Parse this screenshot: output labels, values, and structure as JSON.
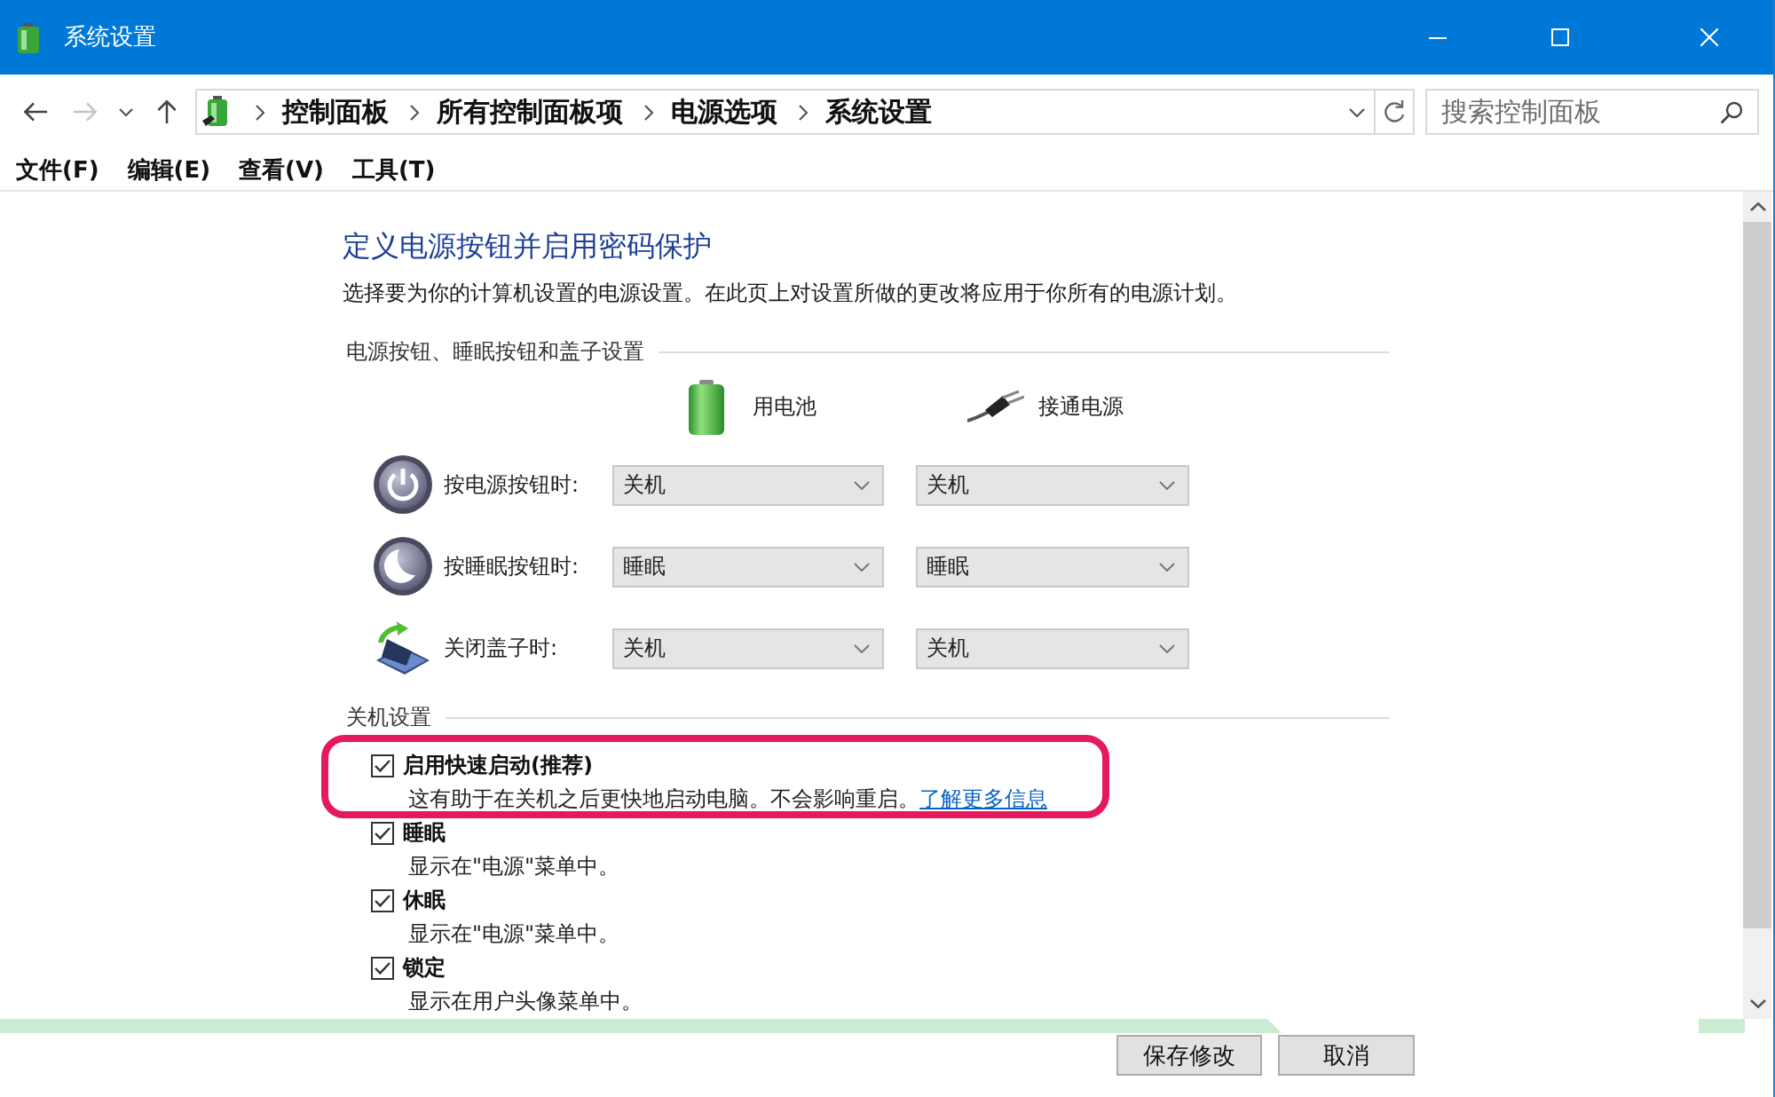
{
  "window": {
    "title": "系统设置"
  },
  "navigation": {
    "back": {
      "disabled": false
    },
    "forward": {
      "disabled": true
    }
  },
  "address_bar": {
    "path": [
      "控制面板",
      "所有控制面板项",
      "电源选项",
      "系统设置"
    ]
  },
  "search": {
    "placeholder": "搜索控制面板"
  },
  "menu": [
    "文件(F)",
    "编辑(E)",
    "查看(V)",
    "工具(T)"
  ],
  "page": {
    "title": "定义电源按钮并启用密码保护",
    "description": "选择要为你的计算机设置的电源设置。在此页上对设置所做的更改将应用于你所有的电源计划。"
  },
  "button_settings": {
    "heading": "电源按钮、睡眠按钮和盖子设置",
    "columns": [
      {
        "kind": "battery",
        "label": "用电池"
      },
      {
        "kind": "plugged_in",
        "label": "接通电源"
      }
    ],
    "rows": [
      {
        "kind": "power",
        "label": "按电源按钮时:",
        "values": [
          "关机",
          "关机"
        ]
      },
      {
        "kind": "sleep",
        "label": "按睡眠按钮时:",
        "values": [
          "睡眠",
          "睡眠"
        ]
      },
      {
        "kind": "lid",
        "label": "关闭盖子时:",
        "values": [
          "关机",
          "关机"
        ]
      }
    ]
  },
  "shutdown_settings": {
    "heading": "关机设置",
    "options": [
      {
        "label": "启用快速启动(推荐)",
        "checked": true,
        "highlighted": true,
        "description": "这有助于在关机之后更快地启动电脑。不会影响重启。",
        "link": "了解更多信息"
      },
      {
        "label": "睡眠",
        "checked": true,
        "highlighted": false,
        "description": "显示在\"电源\"菜单中。"
      },
      {
        "label": "休眠",
        "checked": true,
        "highlighted": false,
        "description": "显示在\"电源\"菜单中。"
      },
      {
        "label": "锁定",
        "checked": true,
        "highlighted": false,
        "description": "显示在用户头像菜单中。"
      }
    ]
  },
  "buttons": [
    "保存修改",
    "取消"
  ]
}
